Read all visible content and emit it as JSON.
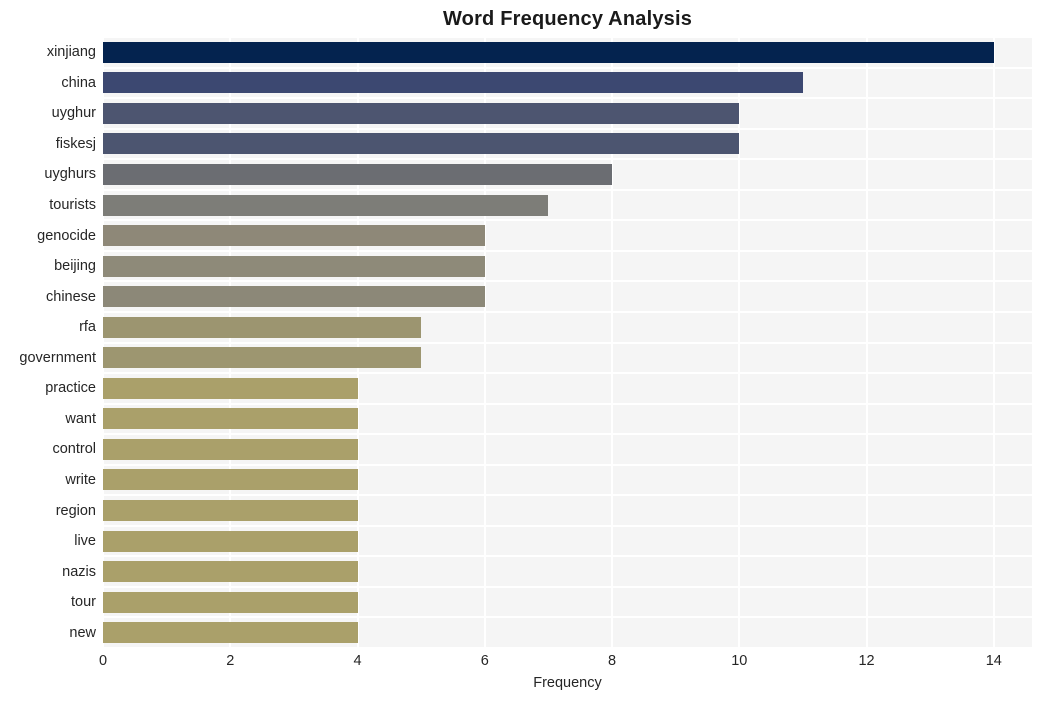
{
  "chart_data": {
    "type": "bar",
    "orientation": "horizontal",
    "title": "Word Frequency Analysis",
    "xlabel": "Frequency",
    "ylabel": "",
    "xlim": [
      0,
      14.6
    ],
    "xticks": [
      0,
      2,
      4,
      6,
      8,
      10,
      12,
      14
    ],
    "xtick_labels": [
      "0",
      "2",
      "4",
      "6",
      "8",
      "10",
      "12",
      "14"
    ],
    "grid": true,
    "grid_axis": "both",
    "legend": false,
    "categories": [
      "xinjiang",
      "china",
      "uyghur",
      "fiskesj",
      "uyghurs",
      "tourists",
      "genocide",
      "beijing",
      "chinese",
      "rfa",
      "government",
      "practice",
      "want",
      "control",
      "write",
      "region",
      "live",
      "nazis",
      "tour",
      "new"
    ],
    "values": [
      14,
      11,
      10,
      10,
      8,
      7,
      6,
      6,
      6,
      5,
      5,
      4,
      4,
      4,
      4,
      4,
      4,
      4,
      4,
      4
    ],
    "bar_colors": [
      "#04234f",
      "#3c4871",
      "#4d5570",
      "#4c5570",
      "#6b6d72",
      "#7d7d78",
      "#8e8878",
      "#8e8a79",
      "#8c8878",
      "#9c9570",
      "#9d9670",
      "#aaa06a",
      "#aaa06a",
      "#aaa06a",
      "#aaa06a",
      "#aaa06a",
      "#aaa06a",
      "#aaa06a",
      "#aaa06a",
      "#aaa06a"
    ],
    "plot_background": "#f5f5f5",
    "figure_background": "#ffffff",
    "gridline_color": "#ffffff"
  }
}
